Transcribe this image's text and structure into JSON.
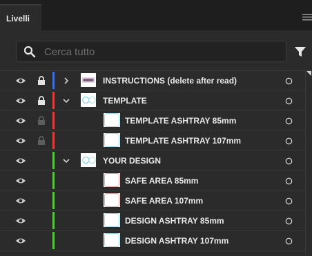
{
  "panel": {
    "tab_label": "Livelli"
  },
  "search": {
    "placeholder": "Cerca tutto"
  },
  "layers": [
    {
      "label": "INSTRUCTIONS (delete after read)",
      "color": "#3e6fd8",
      "expandable": true,
      "expanded": false,
      "locked": true,
      "lock_dim": false,
      "thumb": "instructions-thumbnail",
      "level": 0
    },
    {
      "label": "TEMPLATE",
      "color": "#e0403e",
      "expandable": true,
      "expanded": true,
      "locked": true,
      "lock_dim": false,
      "thumb": "circles-thumbnail",
      "level": 0
    },
    {
      "label": "TEMPLATE ASHTRAY 85mm",
      "color": "#e0403e",
      "expandable": false,
      "locked": true,
      "lock_dim": true,
      "thumb": "circle-thumbnail-cyan",
      "level": 1
    },
    {
      "label": "TEMPLATE ASHTRAY 107mm",
      "color": "#e0403e",
      "expandable": false,
      "locked": true,
      "lock_dim": true,
      "thumb": "circle-thumbnail-cyan",
      "level": 1
    },
    {
      "label": "YOUR DESIGN",
      "color": "#59c73e",
      "expandable": true,
      "expanded": true,
      "locked": false,
      "thumb": "circles-thumbnail",
      "level": 0
    },
    {
      "label": "SAFE AREA 85mm",
      "color": "#59c73e",
      "expandable": false,
      "locked": false,
      "thumb": "circle-thumbnail-red",
      "level": 1
    },
    {
      "label": "SAFE AREA 107mm",
      "color": "#59c73e",
      "expandable": false,
      "locked": false,
      "thumb": "circle-thumbnail-red",
      "level": 1
    },
    {
      "label": "DESIGN ASHTRAY 85mm",
      "color": "#59c73e",
      "expandable": false,
      "locked": false,
      "thumb": "circle-thumbnail-cyan",
      "level": 1
    },
    {
      "label": "DESIGN ASHTRAY 107mm",
      "color": "#59c73e",
      "expandable": false,
      "locked": false,
      "thumb": "circle-thumbnail-cyan",
      "level": 1
    }
  ]
}
